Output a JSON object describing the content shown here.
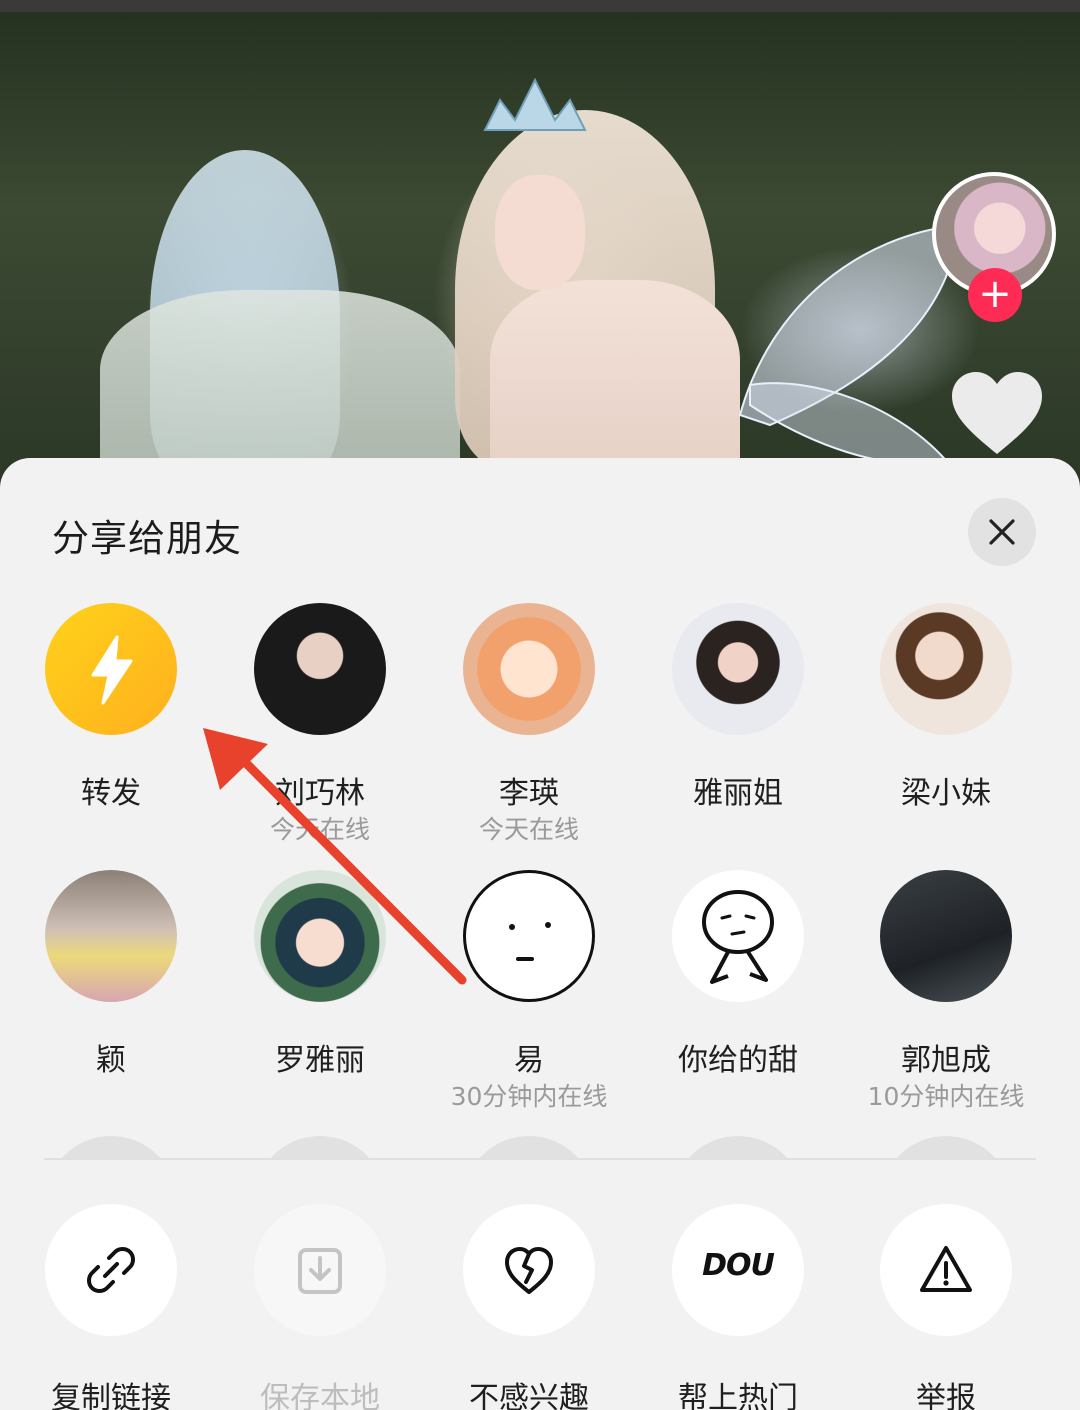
{
  "sheet": {
    "title": "分享给朋友"
  },
  "friends": [
    {
      "name": "转发",
      "status": ""
    },
    {
      "name": "刘巧林",
      "status": "今天在线"
    },
    {
      "name": "李瑛",
      "status": "今天在线"
    },
    {
      "name": "雅丽姐",
      "status": ""
    },
    {
      "name": "梁小妹",
      "status": ""
    },
    {
      "name": "颖",
      "status": ""
    },
    {
      "name": "罗雅丽",
      "status": ""
    },
    {
      "name": "易",
      "status": "30分钟内在线"
    },
    {
      "name": "你给的甜",
      "status": ""
    },
    {
      "name": "郭旭成",
      "status": "10分钟内在线"
    }
  ],
  "actions": [
    {
      "label": "复制链接",
      "icon": "link-icon",
      "enabled": true
    },
    {
      "label": "保存本地",
      "icon": "download-icon",
      "enabled": false
    },
    {
      "label": "不感兴趣",
      "icon": "broken-heart-icon",
      "enabled": true
    },
    {
      "label": "帮上热门",
      "icon": "dou-plus-icon",
      "enabled": true,
      "icon_text": "DOU"
    },
    {
      "label": "举报",
      "icon": "warning-icon",
      "enabled": true
    }
  ],
  "colors": {
    "accent_red": "#fe2c55",
    "forward_yellow": "#ffc21a",
    "annotation_arrow": "#e8412c",
    "sheet_bg": "#f2f2f2"
  }
}
